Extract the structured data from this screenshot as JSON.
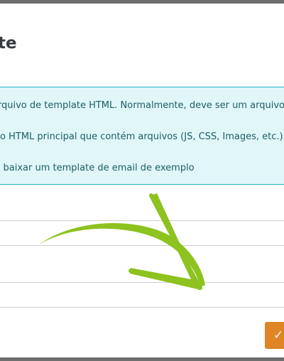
{
  "modal": {
    "title": "te",
    "info_lines": [
      "Envie um arquivo de template HTML. Normalmente, deve ser um arquivo .zip contendo:",
      "- Um arquivo HTML principal que contém arquivos (JS, CSS, Images, etc.)",
      "- Você pode baixar um template de email de exemplo"
    ],
    "confirm_glyph": "✓",
    "accent_color": "#e08525",
    "info_color": "#e0f6f8",
    "annotation_color": "#8dc21f"
  }
}
